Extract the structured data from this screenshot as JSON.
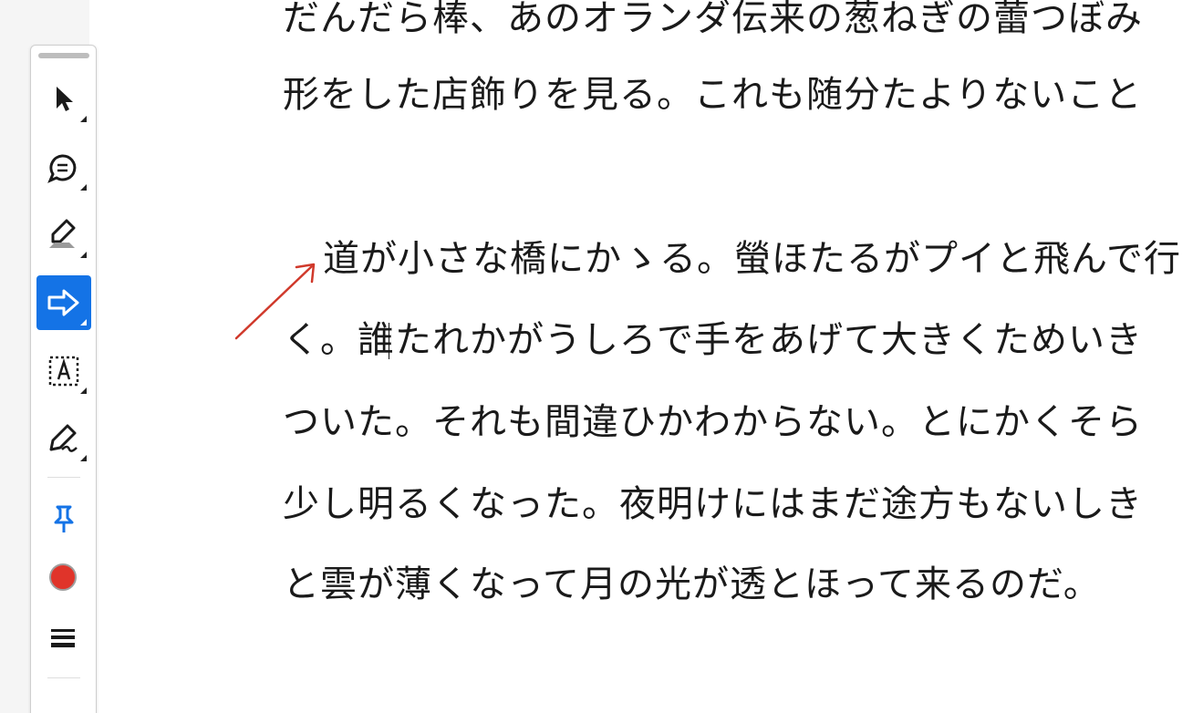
{
  "toolbar": {
    "tools": [
      {
        "name": "select-tool",
        "icon": "cursor-arrow-icon",
        "active": false
      },
      {
        "name": "comment-tool",
        "icon": "speech-bubble-icon",
        "active": false
      },
      {
        "name": "highlight-tool",
        "icon": "highlighter-pen-icon",
        "active": false
      },
      {
        "name": "arrow-tool",
        "icon": "right-arrow-icon",
        "active": true
      },
      {
        "name": "text-box-tool",
        "icon": "text-box-icon",
        "active": false
      },
      {
        "name": "sign-tool",
        "icon": "signature-pen-icon",
        "active": false
      },
      {
        "name": "pin-tool",
        "icon": "pushpin-icon",
        "active": false
      },
      {
        "name": "color-tool",
        "icon": "color-swatch-icon",
        "active": false
      },
      {
        "name": "stroke-weight-tool",
        "icon": "line-weight-icon",
        "active": false
      }
    ]
  },
  "document": {
    "lines": [
      "だんだら棒、あのオランダ伝来の葱ねぎの蕾つぼみ",
      "形をした店飾りを見る。これも随分たよりないこと",
      "道が小さな橋にかゝる。螢ほたるがプイと飛んで行",
      "く。誰たれかがうしろで手をあげて大きくためいき",
      "ついた。それも間違ひかわからない。とにかくそら",
      "少し明るくなった。夜明けにはまだ途方もないしき",
      "と雲が薄くなって月の光が透とほって来るのだ。"
    ]
  },
  "colors": {
    "accent": "#1473e6",
    "annotation_arrow": "#d0392b",
    "color_swatch": "#e0342a",
    "pin": "#1473e6"
  }
}
